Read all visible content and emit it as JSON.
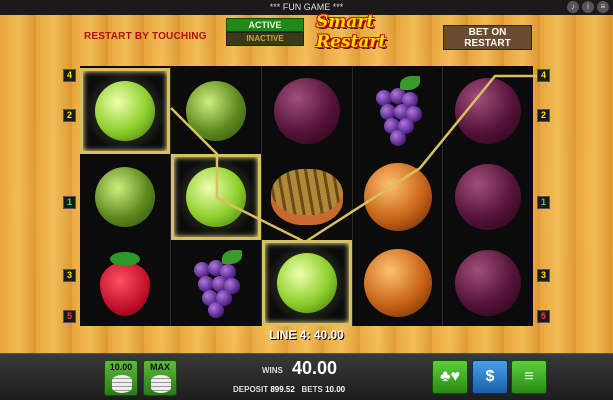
{
  "window": {
    "title": "*** FUN GAME ***",
    "icons": [
      "sound-icon",
      "info-icon",
      "menu-icon"
    ]
  },
  "header": {
    "restart_label": "RESTART BY TOUCHING",
    "toggle_active": "ACTIVE",
    "toggle_inactive": "INACTIVE",
    "logo": "Smart Restart",
    "bet_on_restart": "BET ON RESTART"
  },
  "lines": {
    "left": [
      {
        "number": "4",
        "color": "#ffe000"
      },
      {
        "number": "2",
        "color": "#ffe000"
      },
      {
        "number": "1",
        "color": "#4cd64c"
      },
      {
        "number": "3",
        "color": "#ffe000"
      },
      {
        "number": "5",
        "color": "#ff3030"
      }
    ],
    "right": [
      {
        "number": "4",
        "color": "#ffe000"
      },
      {
        "number": "2",
        "color": "#ffe000"
      },
      {
        "number": "1",
        "color": "#4cd64c"
      },
      {
        "number": "3",
        "color": "#ffe000"
      },
      {
        "number": "5",
        "color": "#ff3030"
      }
    ]
  },
  "reels": [
    [
      "lime",
      "lime",
      "strawberry"
    ],
    [
      "lime",
      "lime",
      "grapes"
    ],
    [
      "plum",
      "melon",
      "lime"
    ],
    [
      "grapes",
      "orange",
      "orange"
    ],
    [
      "plum",
      "plum",
      "plum"
    ]
  ],
  "win": {
    "line_text": "LINE 4: 40.00"
  },
  "bottom": {
    "bet_button": "10.00",
    "max_button": "MAX",
    "wins_label": "WINS",
    "wins_value": "40.00",
    "deposit_label": "DEPOSIT",
    "deposit_value": "899.52",
    "bets_label": "BETS",
    "bets_value": "10.00",
    "gamble_icon": "cards-icon",
    "cashout_icon": "money-bag-icon",
    "menu_icon": "hamburger-icon"
  },
  "colors": {
    "accent_green": "#2a8a18",
    "win_frame": "#d8c060",
    "wood": "#e8a53a"
  }
}
